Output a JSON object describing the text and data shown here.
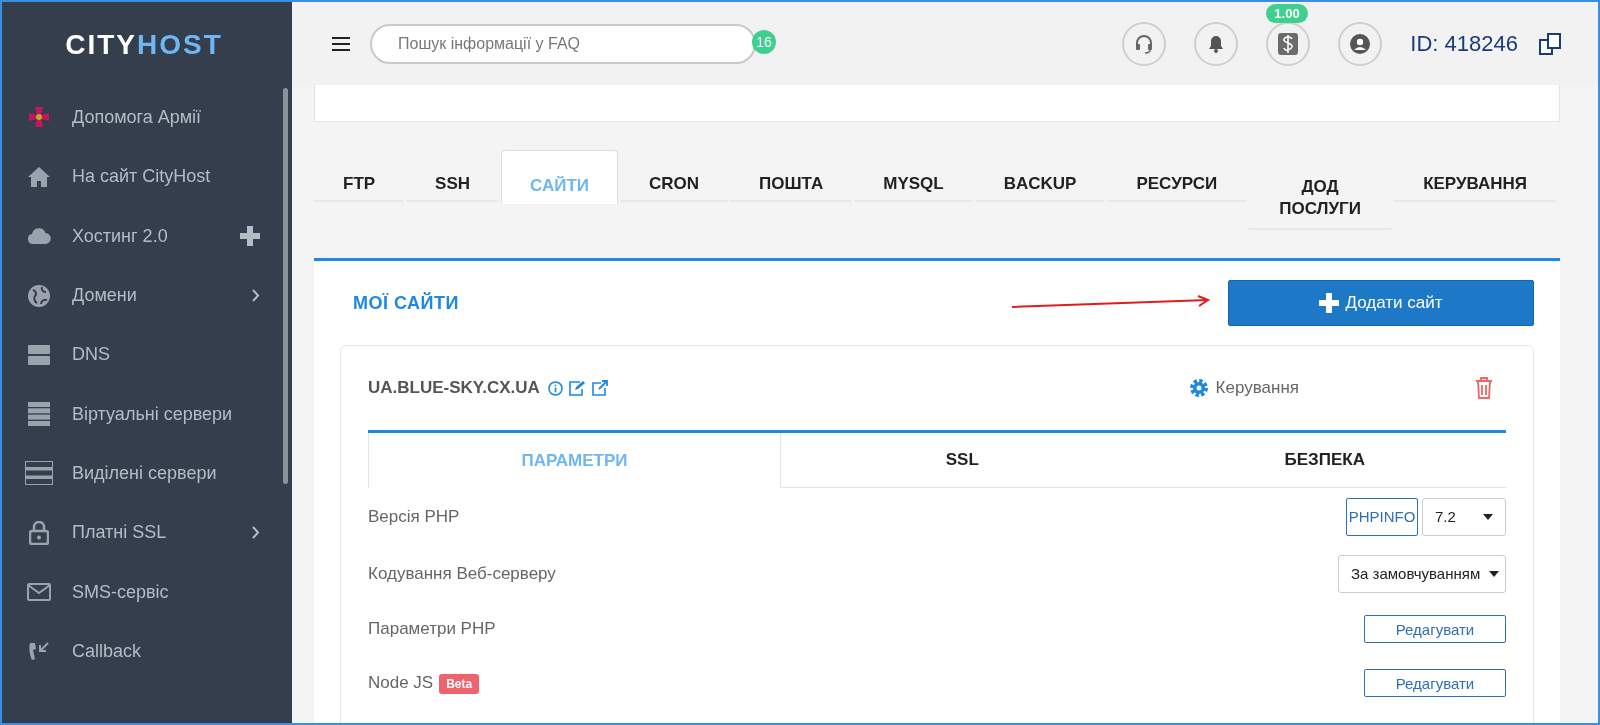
{
  "logo": {
    "part_1": "CITY",
    "part_2": "HOST"
  },
  "sidebar": {
    "items": [
      {
        "label": "Допомога Армії",
        "has_submenu": false,
        "add_button": false
      },
      {
        "label": "На сайт CityHost",
        "has_submenu": false,
        "add_button": false
      },
      {
        "label": "Хостинг 2.0",
        "has_submenu": false,
        "add_button": true
      },
      {
        "label": "Домени",
        "has_submenu": true,
        "add_button": false
      },
      {
        "label": "DNS",
        "has_submenu": false,
        "add_button": false
      },
      {
        "label": "Віртуальні сервери",
        "has_submenu": false,
        "add_button": false
      },
      {
        "label": "Виділені сервери",
        "has_submenu": false,
        "add_button": false
      },
      {
        "label": "Платні SSL",
        "has_submenu": true,
        "add_button": false
      },
      {
        "label": "SMS-сервіс",
        "has_submenu": false,
        "add_button": false
      },
      {
        "label": "Callback",
        "has_submenu": false,
        "add_button": false
      }
    ]
  },
  "topbar": {
    "search": {
      "placeholder": "Пошук інформації у FAQ",
      "badge": "16"
    },
    "balance_badge": "1.00",
    "account_id": "ID: 418246"
  },
  "tabs": [
    {
      "label": "FTP",
      "selected": false
    },
    {
      "label": "SSH",
      "selected": false
    },
    {
      "label": "САЙТИ",
      "selected": true
    },
    {
      "label": "CRON",
      "selected": false
    },
    {
      "label": "ПОШТА",
      "selected": false
    },
    {
      "label": "MYSQL",
      "selected": false
    },
    {
      "label": "BACKUP",
      "selected": false
    },
    {
      "label": "РЕСУРСИ",
      "selected": false
    },
    {
      "label": "ДОД ПОСЛУГИ",
      "selected": false
    },
    {
      "label": "КЕРУВАННЯ",
      "selected": false
    }
  ],
  "panel": {
    "title": "МОЇ САЙТИ",
    "add_button": "Додати сайт",
    "site": {
      "domain": "UA.BLUE-SKY.CX.UA",
      "manage": "Керування",
      "subtabs": [
        {
          "label": "ПАРАМЕТРИ",
          "selected": true
        },
        {
          "label": "SSL",
          "selected": false
        },
        {
          "label": "БЕЗПЕКА",
          "selected": false
        }
      ],
      "settings": [
        {
          "kind": "php",
          "label": "Версія PHP",
          "button": "PHPINFO",
          "value": "7.2"
        },
        {
          "kind": "select",
          "label": "Кодування Веб-серверу",
          "value": "За замовчуванням"
        },
        {
          "kind": "edit",
          "label": "Параметри PHP",
          "button": "Редагувати"
        },
        {
          "kind": "edit",
          "label": "Node JS",
          "badge": "Beta",
          "button": "Редагувати"
        }
      ]
    }
  }
}
